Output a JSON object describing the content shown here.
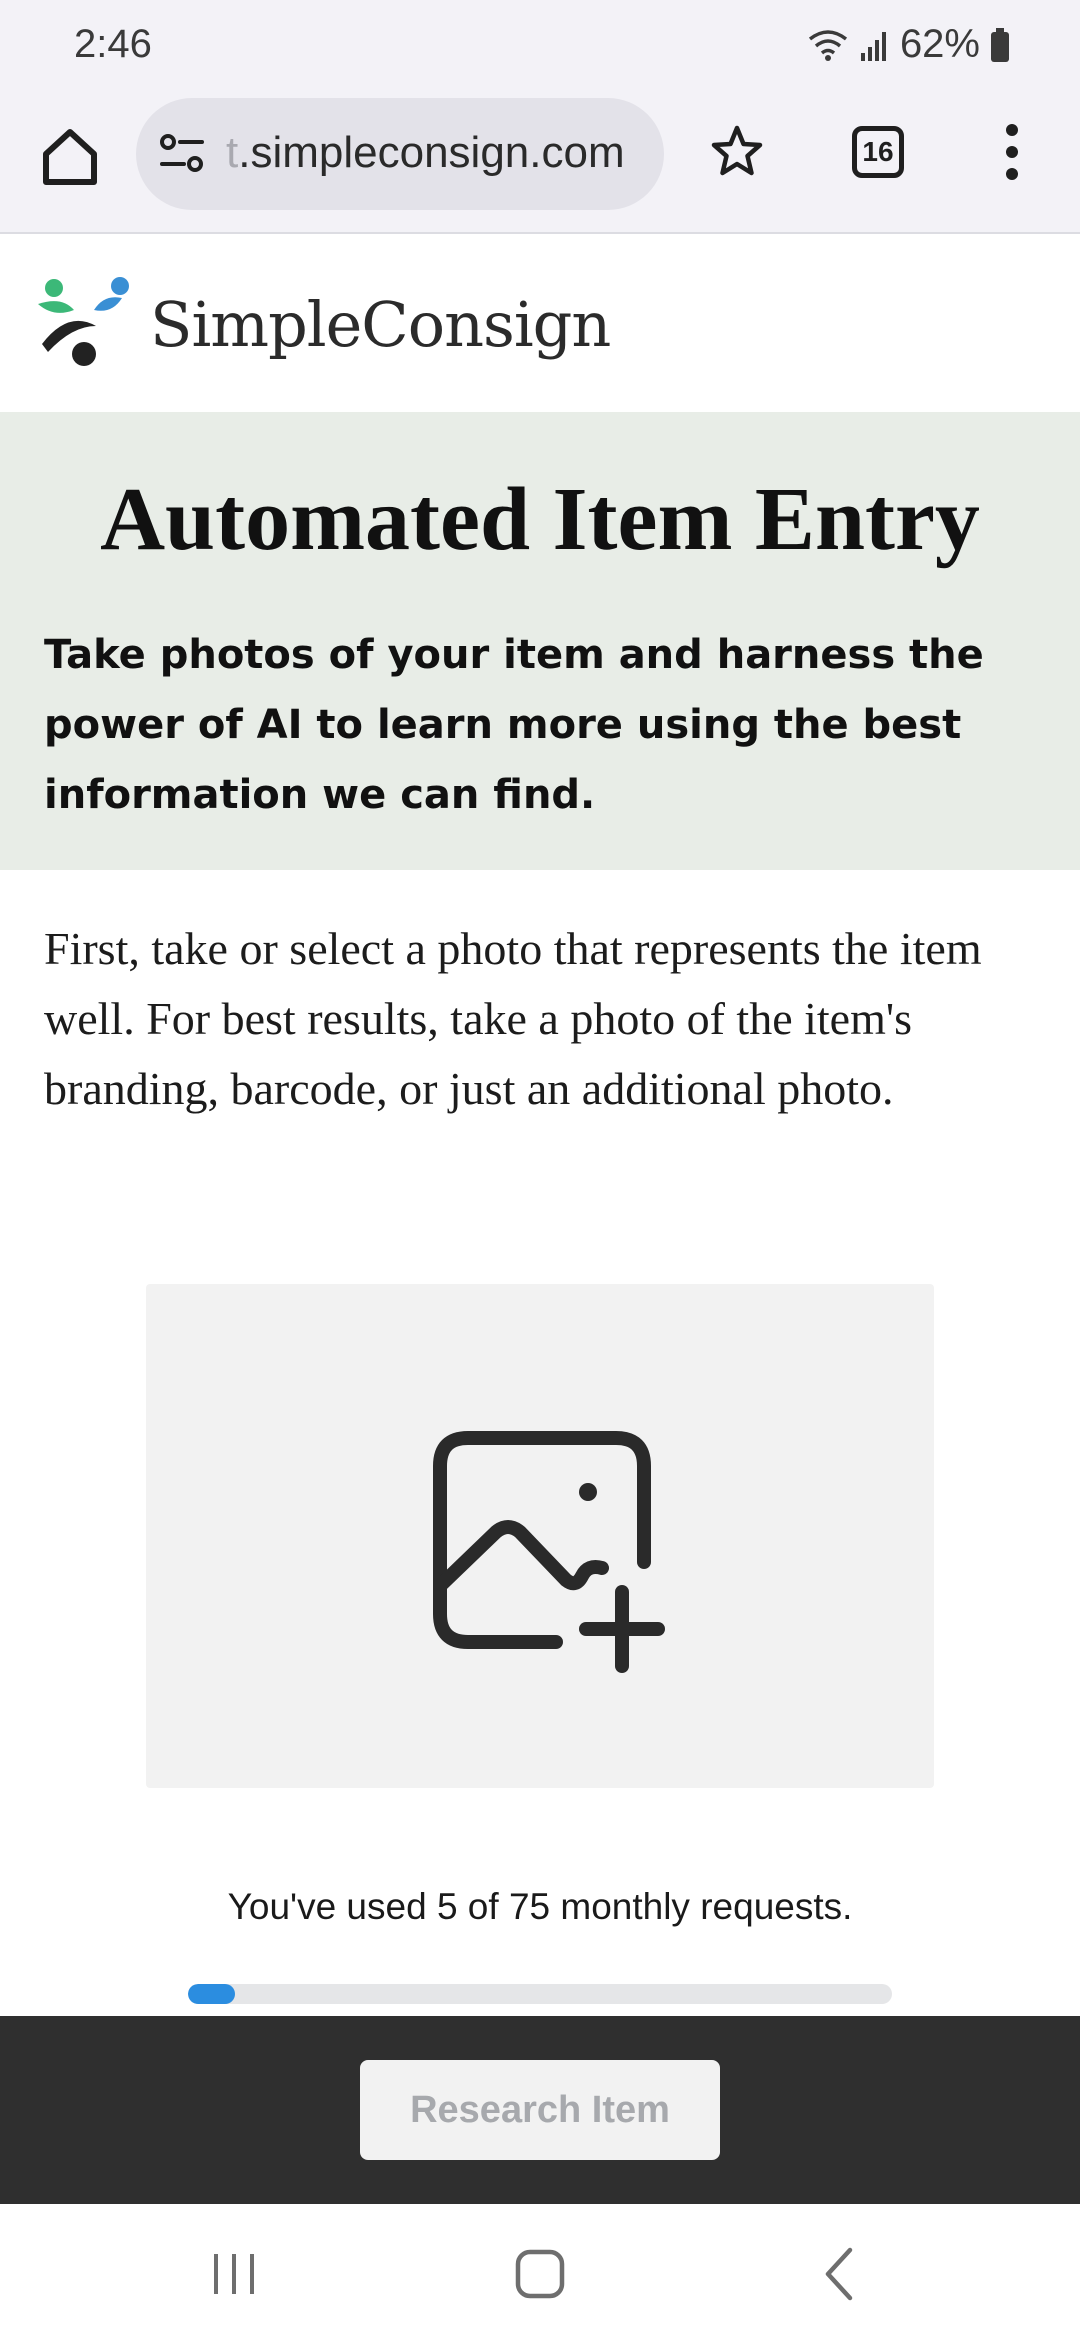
{
  "status_bar": {
    "time": "2:46",
    "battery_percent": "62%",
    "wifi_icon": "wifi-icon",
    "signal_icon": "signal-icon",
    "battery_icon": "battery-icon"
  },
  "browser": {
    "url_prefix": "t",
    "url_main": ".simpleconsign.com",
    "tab_count": "16",
    "icons": [
      "home-icon",
      "site-settings-icon",
      "star-icon",
      "tabs-icon",
      "more-vert-icon"
    ]
  },
  "site": {
    "brand_name": "SimpleConsign",
    "brand_colors": [
      "#3cb878",
      "#3a8fd4",
      "#222222"
    ]
  },
  "hero": {
    "title": "Automated Item Entry",
    "subtitle": "Take photos of your item and harness the power of AI to learn more using the best information we can find.",
    "background": "#e8ede7"
  },
  "intro": {
    "text": "First, take or select a photo that represents the item well. For best results, take a photo of the item's branding, barcode, or just an additional photo."
  },
  "upload": {
    "icon": "add-photo-icon"
  },
  "usage": {
    "text": "You've used 5 of 75 monthly requests.",
    "used": 5,
    "limit": 75,
    "progress_color": "#2b8de0"
  },
  "actions": {
    "research_label": "Research Item"
  },
  "nav": {
    "icons": [
      "recents-icon",
      "home-nav-icon",
      "back-icon"
    ]
  }
}
